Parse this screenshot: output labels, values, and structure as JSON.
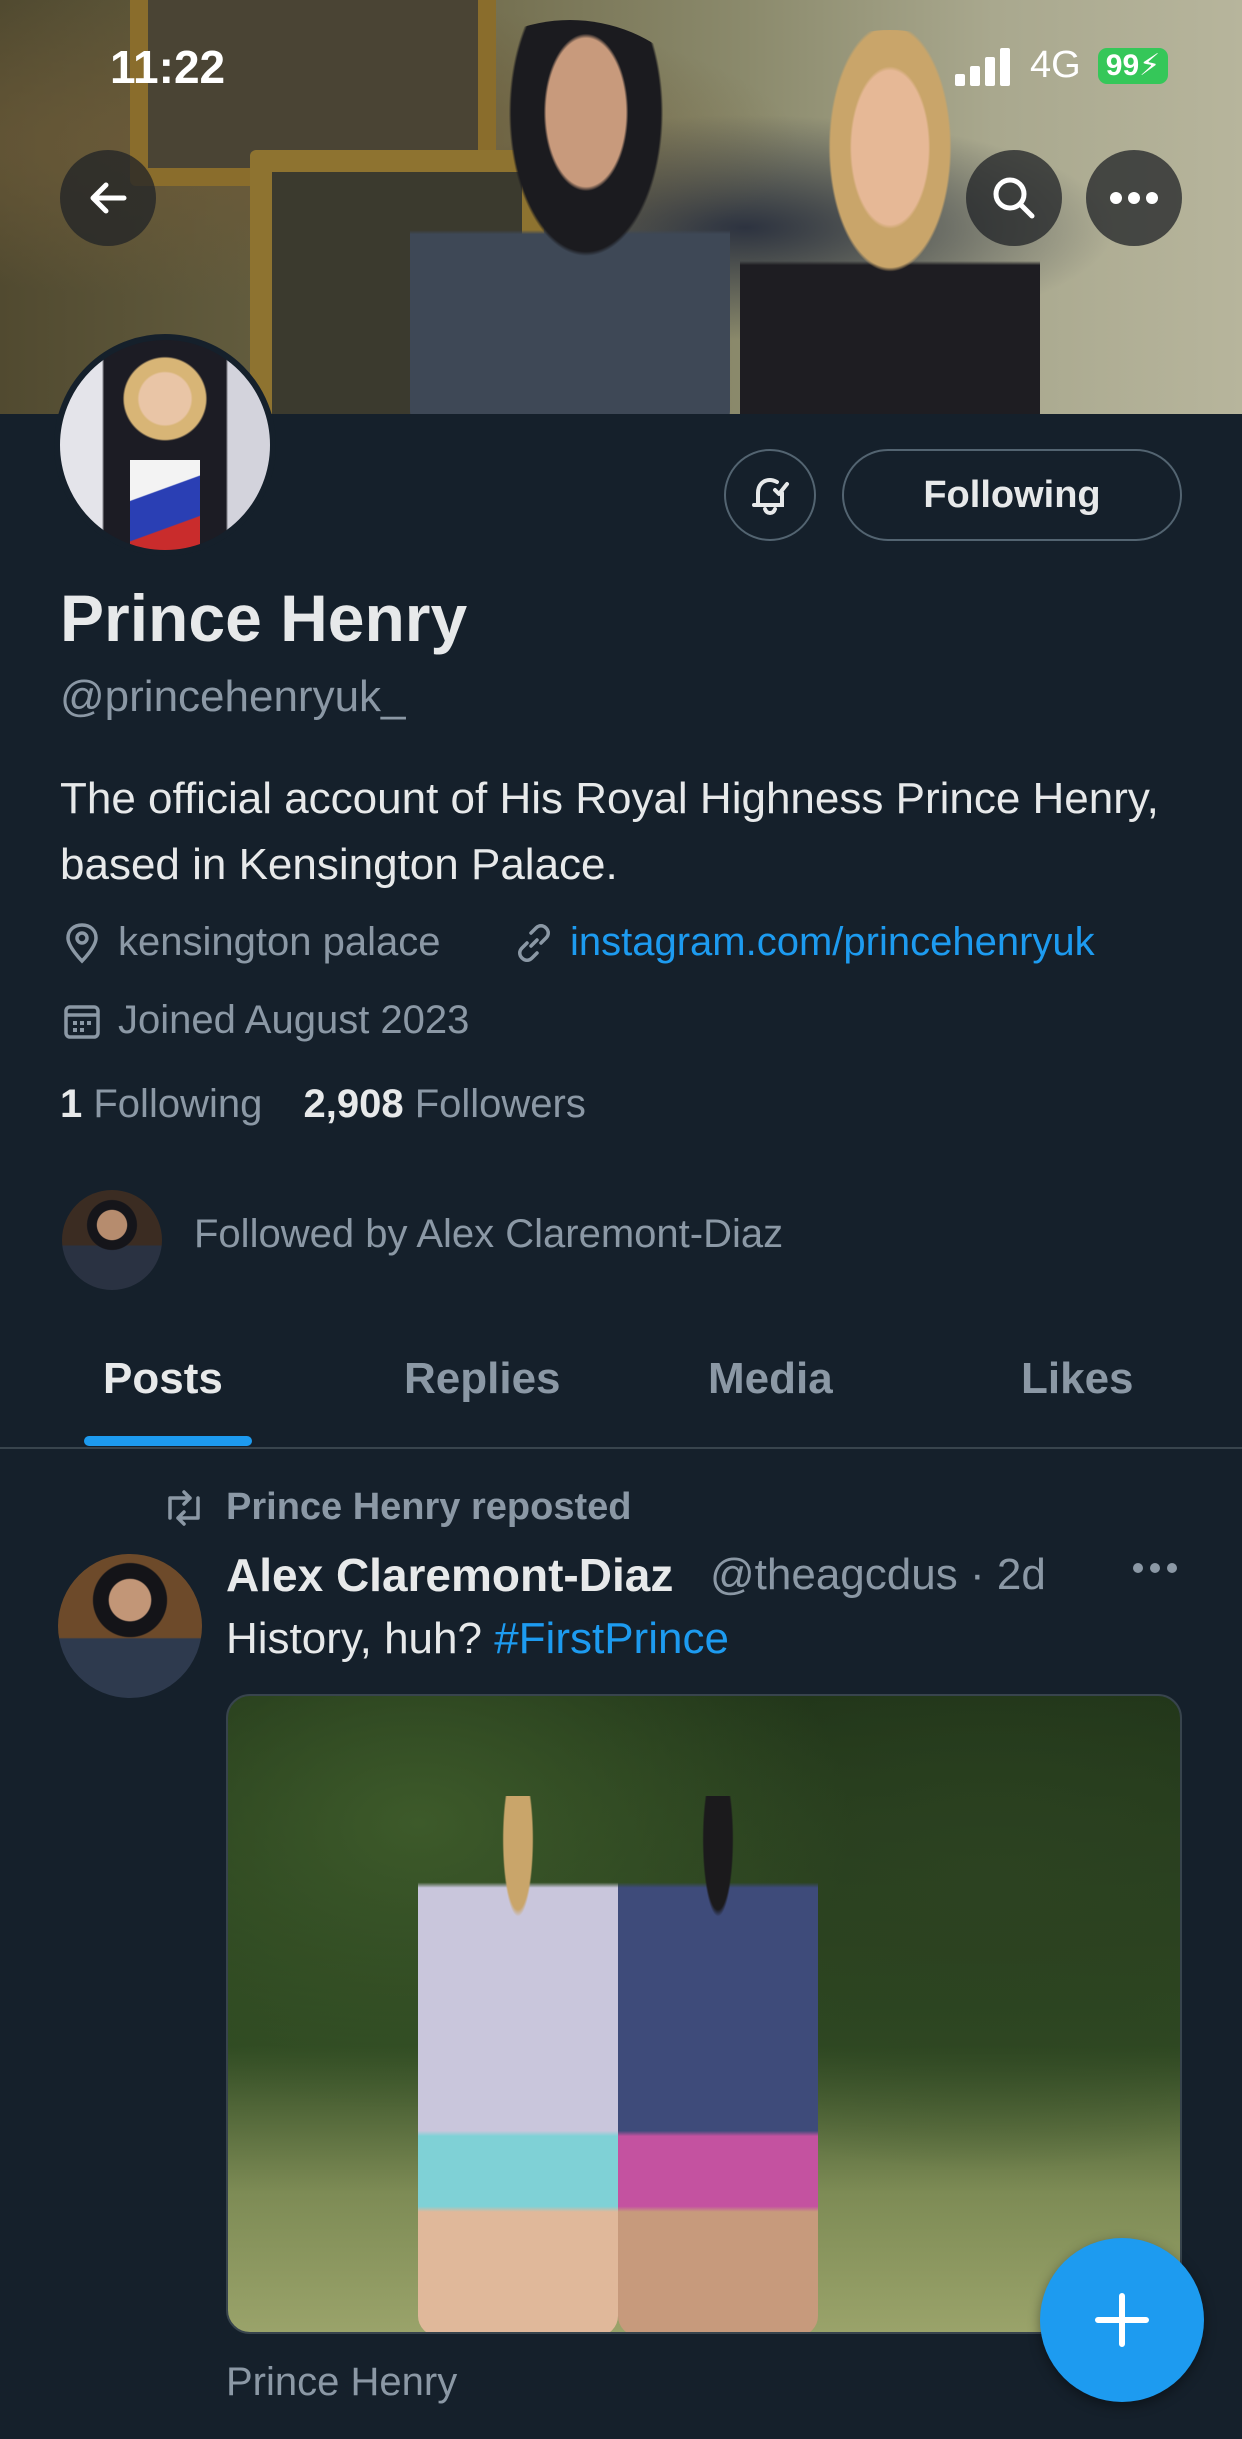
{
  "status_bar": {
    "time": "11:22",
    "network": "4G",
    "battery": "99"
  },
  "header": {
    "back_icon": "arrow-left-icon",
    "search_icon": "search-icon",
    "more_icon": "more-horizontal-icon"
  },
  "profile": {
    "name": "Prince Henry",
    "handle": "@princehenryuk_",
    "bio": "The official account of His Royal Highness Prince Henry, based in Kensington Palace.",
    "location": "kensington palace",
    "website": "instagram.com/princehenryuk",
    "joined": "Joined August 2023",
    "following_count": "1",
    "following_label": "Following",
    "followers_count": "2,908",
    "followers_label": "Followers",
    "followed_by": "Followed by Alex Claremont-Diaz",
    "follow_button_label": "Following"
  },
  "tabs": [
    {
      "label": "Posts",
      "active": true
    },
    {
      "label": "Replies",
      "active": false
    },
    {
      "label": "Media",
      "active": false
    },
    {
      "label": "Likes",
      "active": false
    }
  ],
  "post": {
    "repost_label": "Prince Henry reposted",
    "author_name": "Alex Claremont-Diaz",
    "author_handle": "@theagcdus",
    "separator": "·",
    "age": "2d",
    "text": "History, huh? ",
    "hashtag": "#FirstPrince",
    "footer": "Prince Henry"
  },
  "colors": {
    "background": "#15202b",
    "accent": "#1d9bf0",
    "secondary_text": "#8b98a5",
    "battery": "#35c759"
  }
}
